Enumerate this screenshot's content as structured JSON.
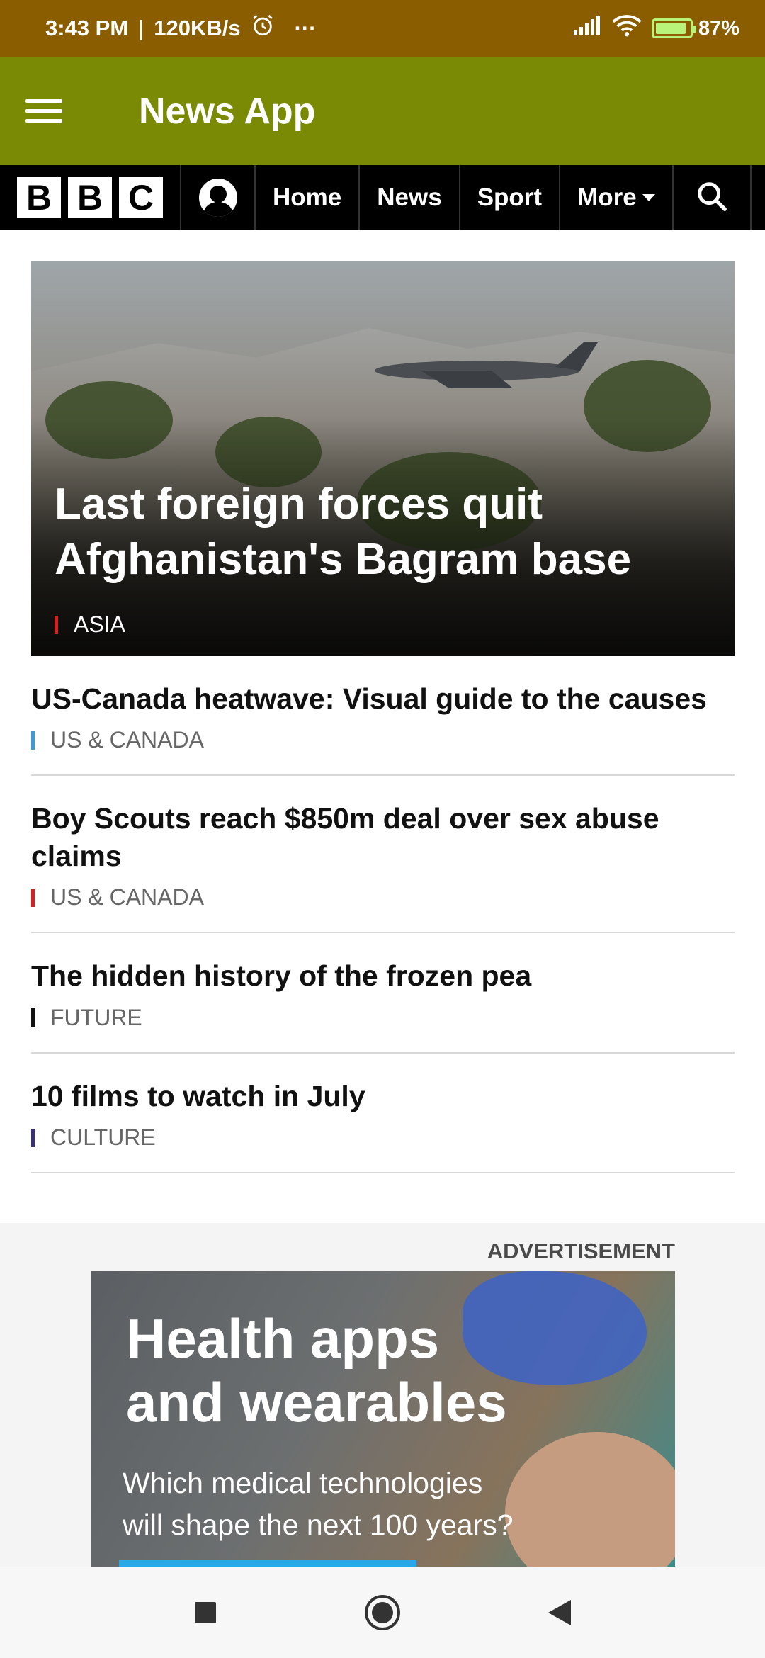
{
  "status_bar": {
    "time": "3:43 PM",
    "speed": "120KB/s",
    "dots": "···",
    "battery": "87%"
  },
  "app_bar": {
    "title": "News App"
  },
  "bbc_nav": {
    "logo_letters": [
      "B",
      "B",
      "C"
    ],
    "links": [
      "Home",
      "News",
      "Sport",
      "More"
    ]
  },
  "hero": {
    "title": "Last foreign forces quit Afghanistan's Bagram base",
    "tag": "ASIA",
    "tag_color": "#d92020"
  },
  "stories": [
    {
      "title": "US-Canada heatwave: Visual guide to the causes",
      "tag": "US & CANADA",
      "tag_color": "#3b9ad9"
    },
    {
      "title": "Boy Scouts reach $850m deal over sex abuse claims",
      "tag": "US & CANADA",
      "tag_color": "#d92020"
    },
    {
      "title": "The hidden history of the frozen pea",
      "tag": "FUTURE",
      "tag_color": "#111111"
    },
    {
      "title": "10 films to watch in July",
      "tag": "CULTURE",
      "tag_color": "#3a2f7a"
    }
  ],
  "advertisement": {
    "label": "ADVERTISEMENT",
    "headline_line1": "Health apps",
    "headline_line2": "and wearables",
    "subtext_line1": "Which medical technologies",
    "subtext_line2": "will shape the next 100 years?"
  },
  "colors": {
    "status_bar": "#8a5d00",
    "app_bar": "#7a8a05",
    "bbc_nav": "#000000"
  },
  "icons": {
    "menu": "hamburger-icon",
    "account": "account-icon",
    "search": "search-icon",
    "alarm": "alarm-icon",
    "signal": "signal-icon",
    "wifi": "wifi-icon",
    "battery": "battery-icon",
    "recent": "square-icon",
    "home": "circle-icon",
    "back": "triangle-back-icon"
  }
}
